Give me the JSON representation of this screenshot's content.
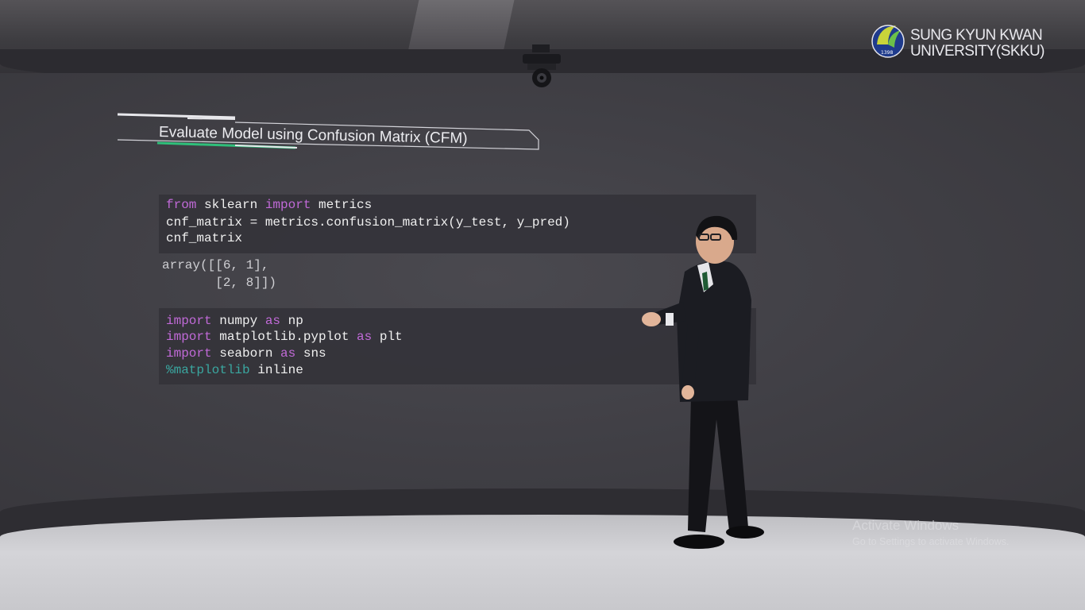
{
  "logo": {
    "line1": "SUNG KYUN KWAN",
    "line2": "UNIVERSITY(SKKU)",
    "seal_text": "1398"
  },
  "slide": {
    "title": "Evaluate Model using Confusion Matrix (CFM)"
  },
  "code_cell_1": {
    "line1": {
      "kw1": "from",
      "t1": " sklearn ",
      "kw2": "import",
      "t2": " metrics"
    },
    "line2": "cnf_matrix = metrics.confusion_matrix(y_test, y_pred)",
    "line3": "cnf_matrix"
  },
  "output_1": {
    "line1": "array([[6, 1],",
    "line2": "       [2, 8]])"
  },
  "code_cell_2": {
    "line1": {
      "kw1": "import",
      "t1": " numpy ",
      "kw2": "as",
      "t2": " np"
    },
    "line2": {
      "kw1": "import",
      "t1": " matplotlib.pyplot ",
      "kw2": "as",
      "t2": " plt"
    },
    "line3": {
      "kw1": "import",
      "t1": " seaborn ",
      "kw2": "as",
      "t2": " sns"
    },
    "line4": {
      "magic": "%matplotlib",
      "t1": " inline"
    }
  },
  "watermark": {
    "title": "Activate Windows",
    "subtitle": "Go to Settings to activate Windows."
  },
  "colors": {
    "keyword": "#c16ad8",
    "magic": "#3aa7a0",
    "accent_green": "#2fbf7a",
    "wall": "#414046"
  }
}
